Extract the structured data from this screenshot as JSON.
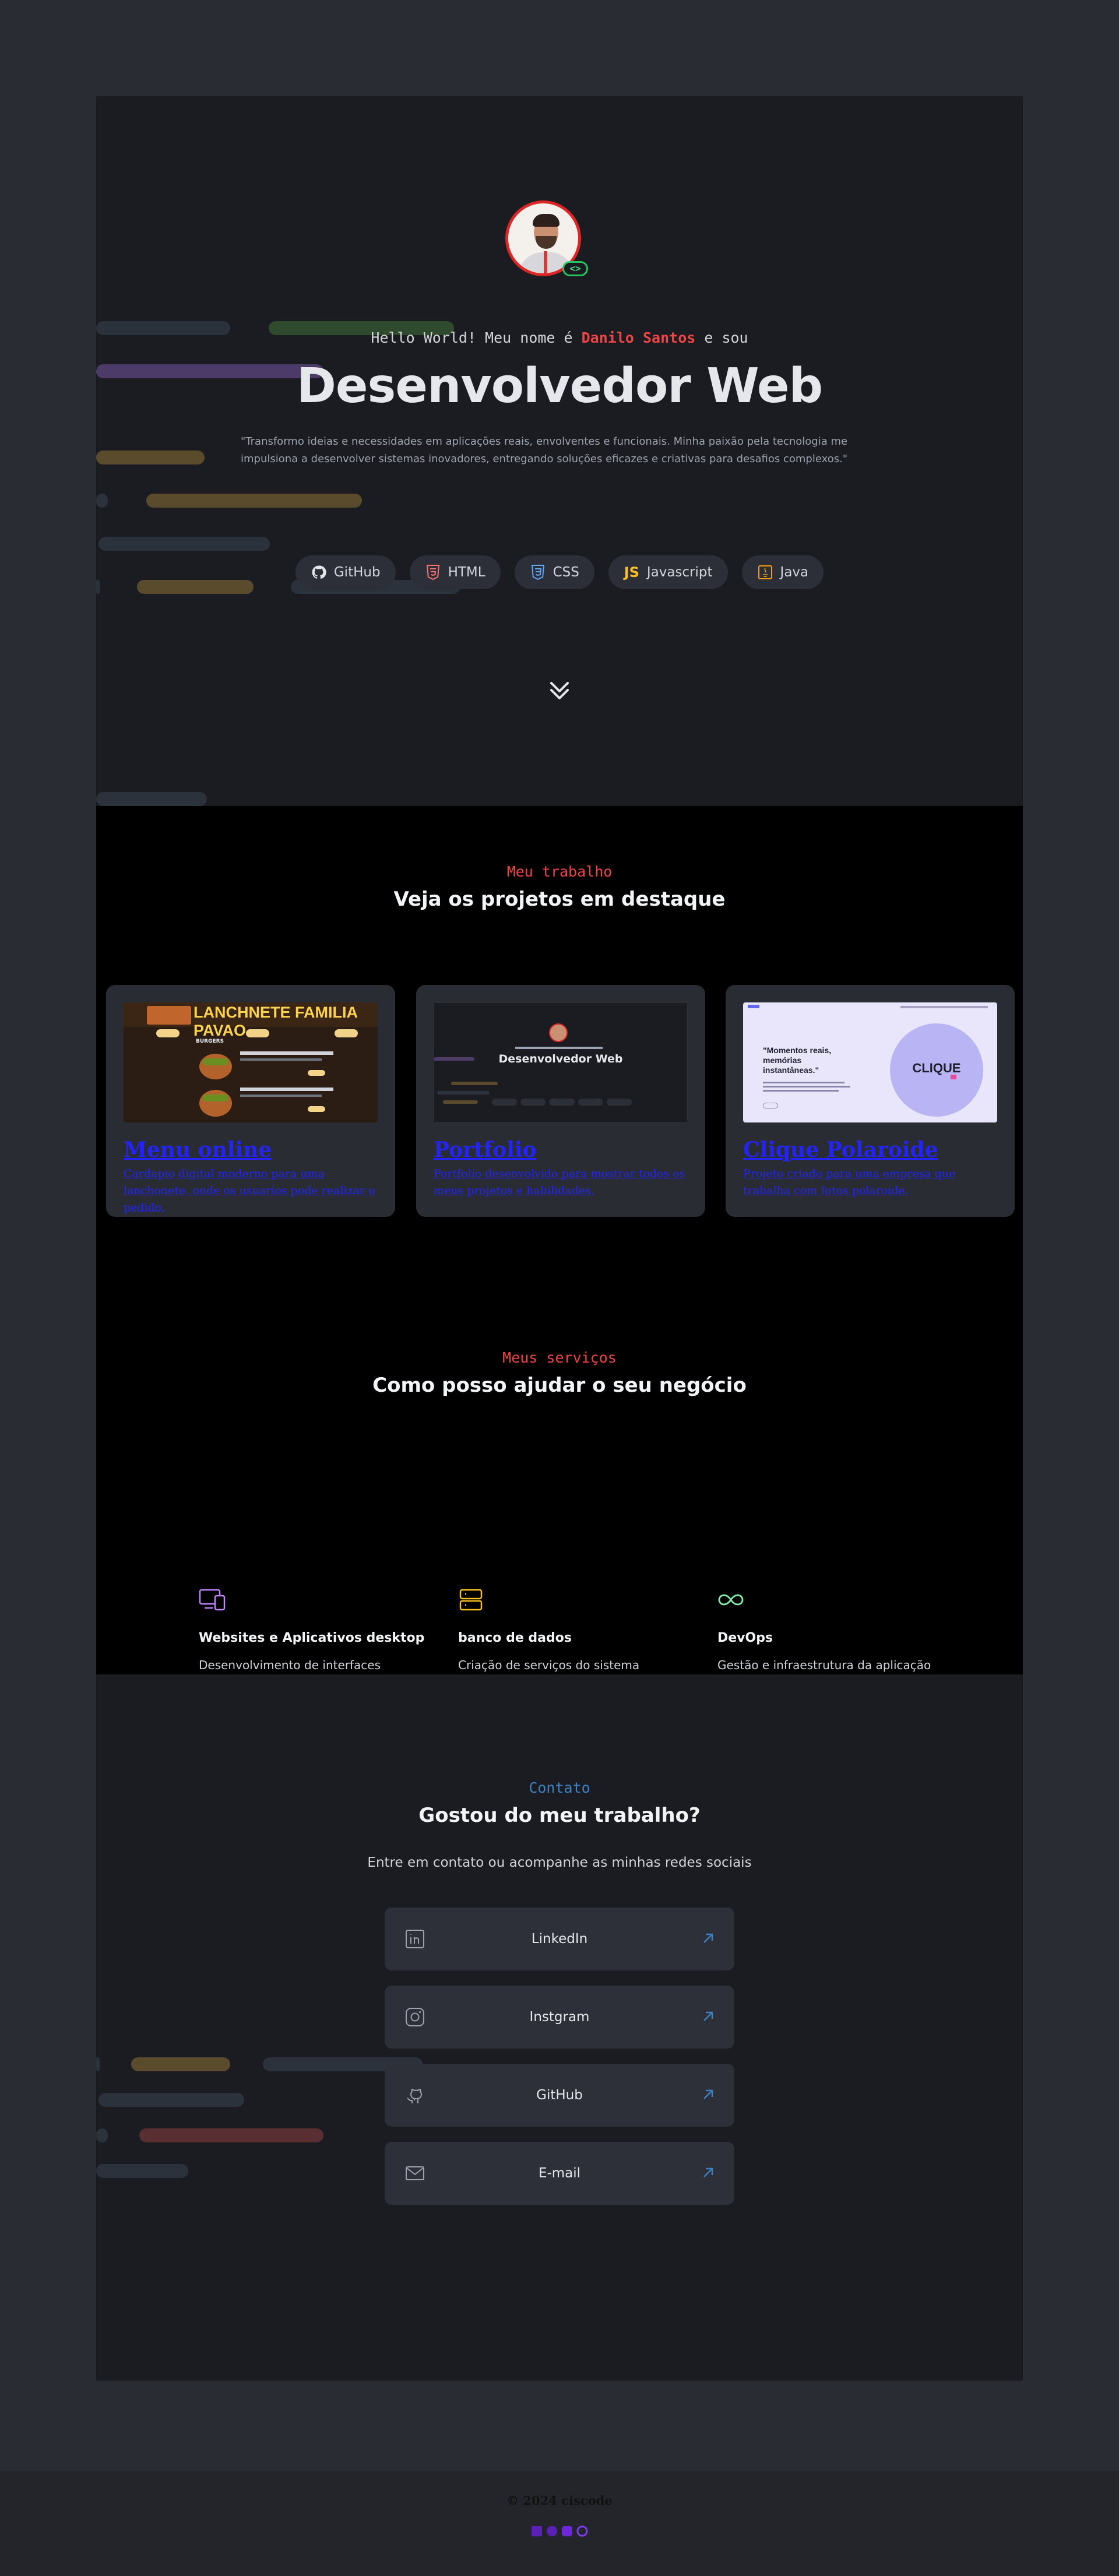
{
  "hero": {
    "greeting_before": "Hello World! Meu nome é ",
    "greeting_name": "Danilo Santos",
    "greeting_after": " e sou",
    "role": "Desenvolvedor Web",
    "quote": "\"Transformo ideias e necessidades em aplicações reais, envolventes e funcionais. Minha paixão pela tecnologia me impulsiona a desenvolver sistemas inovadores, entregando soluções eficazes e criativas para desafios complexos.\"",
    "code_badge": "<>",
    "chips": [
      {
        "label": "GitHub",
        "icon": "github-icon"
      },
      {
        "label": "HTML",
        "icon": "html5-icon"
      },
      {
        "label": "CSS",
        "icon": "css3-icon"
      },
      {
        "label": "Javascript",
        "icon": "javascript-icon"
      },
      {
        "label": "Java",
        "icon": "java-icon"
      }
    ]
  },
  "work": {
    "eyebrow": "Meu trabalho",
    "heading": "Veja os projetos em destaque",
    "projects": [
      {
        "title": "Menu online",
        "description": "Cardapio digital moderno para uma lanchonete, onde os usuarios pode realizar o pedido."
      },
      {
        "title": "Portfolio",
        "description": "Portfolio desenvolvido para mostrar todos os meus projetos e habilidades."
      },
      {
        "title": "Clique Polaroide",
        "description": "Projeto criado para uma empresa que trabalha com fotos polaroide."
      }
    ],
    "thumb_menu": {
      "title": "LANCHNETE FAMILIA PAVAO",
      "section": "BURGERS"
    },
    "thumb_portfolio": {
      "role": "Desenvolvedor Web"
    },
    "thumb_clique": {
      "tagline": "\"Momentos reais, memórias instantâneas.\"",
      "brand": "CLIQUE"
    }
  },
  "services": {
    "eyebrow": "Meus serviços",
    "heading": "Como posso ajudar o seu negócio",
    "items": [
      {
        "title": "Websites e Aplicativos desktop",
        "description": "Desenvolvimento de interfaces",
        "icon": "devices-icon"
      },
      {
        "title": "banco de dados",
        "description": "Criação de serviços do sistema",
        "icon": "server-icon"
      },
      {
        "title": "DevOps",
        "description": "Gestão e infraestrutura da aplicação",
        "icon": "infinity-icon"
      }
    ]
  },
  "contact": {
    "eyebrow": "Contato",
    "heading": "Gostou do meu trabalho?",
    "subtitle": "Entre em contato ou acompanhe as minhas redes sociais",
    "links": [
      {
        "label": "LinkedIn",
        "icon": "linkedin-icon"
      },
      {
        "label": "Instgram",
        "icon": "instagram-icon"
      },
      {
        "label": "GitHub",
        "icon": "github-icon"
      },
      {
        "label": "E-mail",
        "icon": "mail-icon"
      }
    ]
  },
  "footer": {
    "copyright": "© 2024 ciscode"
  },
  "colors": {
    "accent": "#ef4444",
    "page_bg": "#2a2c34",
    "section_bg": "#1b1c21",
    "link": "#2323ff",
    "contact_accent": "#3b82c4"
  }
}
